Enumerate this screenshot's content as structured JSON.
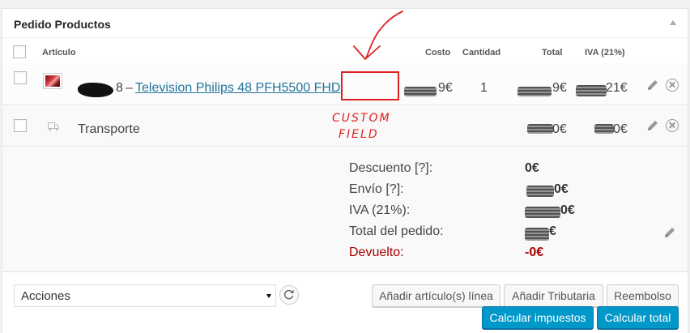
{
  "panel": {
    "title": "Pedido Productos"
  },
  "columns": {
    "item": "Artículo",
    "cost": "Costo",
    "qty": "Cantidad",
    "total": "Total",
    "tax": "IVA (21%)"
  },
  "line_item": {
    "sku_suffix": "8",
    "dash": "–",
    "name": "Television Philips 48 PFH5500 FHD",
    "cost_suffix": "9€",
    "qty": "1",
    "total_suffix": "9€",
    "tax_suffix": "21€"
  },
  "annotation": {
    "label": "CUSTOM FIELD"
  },
  "shipping": {
    "name": "Transporte",
    "total_suffix": "0€",
    "tax_suffix": "0€"
  },
  "totals": {
    "discount_label": "Descuento [?]:",
    "discount_value": "0€",
    "shipping_label": "Envío [?]:",
    "shipping_value_suffix": "0€",
    "tax_label": "IVA (21%):",
    "tax_value_suffix": "0€",
    "order_total_label": "Total del pedido:",
    "order_total_suffix": "€",
    "refunded_label": "Devuelto:",
    "refunded_value": "-0€"
  },
  "actions": {
    "select_value": "Acciones",
    "add_items": "Añadir artículo(s) línea",
    "add_tax": "Añadir Tributaria",
    "refund": "Reembolso",
    "calc_taxes": "Calcular impuestos",
    "calc_total": "Calcular total"
  },
  "colors": {
    "primary_button": "#0097c9",
    "link": "#21759b",
    "refund_text": "#aa0000",
    "annotation": "#e02020"
  },
  "icons": {
    "edit": "pencil-icon",
    "delete": "close-circle-icon",
    "shipping": "truck-icon",
    "refresh": "refresh-icon",
    "collapse": "triangle-up-icon"
  }
}
